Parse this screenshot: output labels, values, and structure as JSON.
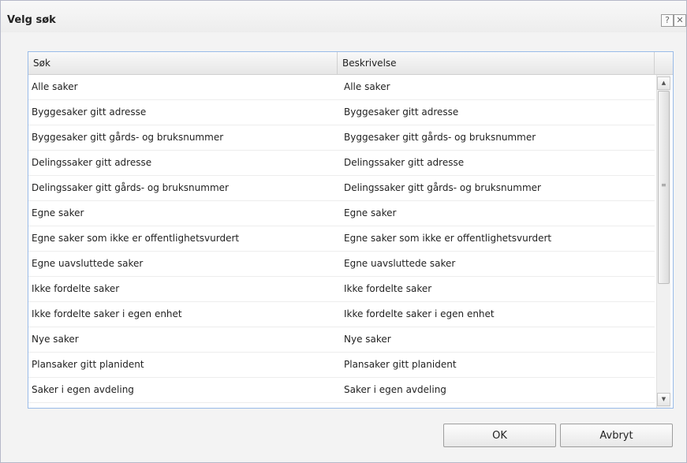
{
  "dialog": {
    "title": "Velg søk",
    "help_label": "?",
    "close_label": "✕"
  },
  "grid": {
    "columns": [
      "Søk",
      "Beskrivelse"
    ],
    "rows": [
      {
        "sok": "Alle saker",
        "beskrivelse": "Alle saker"
      },
      {
        "sok": "Byggesaker gitt adresse",
        "beskrivelse": "Byggesaker gitt adresse"
      },
      {
        "sok": "Byggesaker gitt gårds- og bruksnummer",
        "beskrivelse": "Byggesaker gitt gårds- og bruksnummer"
      },
      {
        "sok": "Delingssaker gitt adresse",
        "beskrivelse": "Delingssaker gitt adresse"
      },
      {
        "sok": "Delingssaker gitt gårds- og bruksnummer",
        "beskrivelse": "Delingssaker gitt gårds- og bruksnummer"
      },
      {
        "sok": "Egne saker",
        "beskrivelse": "Egne saker"
      },
      {
        "sok": "Egne saker som ikke er offentlighetsvurdert",
        "beskrivelse": "Egne saker som ikke er offentlighetsvurdert"
      },
      {
        "sok": "Egne uavsluttede saker",
        "beskrivelse": "Egne uavsluttede saker"
      },
      {
        "sok": "Ikke fordelte saker",
        "beskrivelse": "Ikke fordelte saker"
      },
      {
        "sok": "Ikke fordelte saker i egen enhet",
        "beskrivelse": "Ikke fordelte saker i egen enhet"
      },
      {
        "sok": "Nye saker",
        "beskrivelse": "Nye saker"
      },
      {
        "sok": "Plansaker gitt planident",
        "beskrivelse": "Plansaker gitt planident"
      },
      {
        "sok": "Saker i egen avdeling",
        "beskrivelse": "Saker i egen avdeling"
      }
    ]
  },
  "buttons": {
    "ok": "OK",
    "cancel": "Avbryt"
  }
}
